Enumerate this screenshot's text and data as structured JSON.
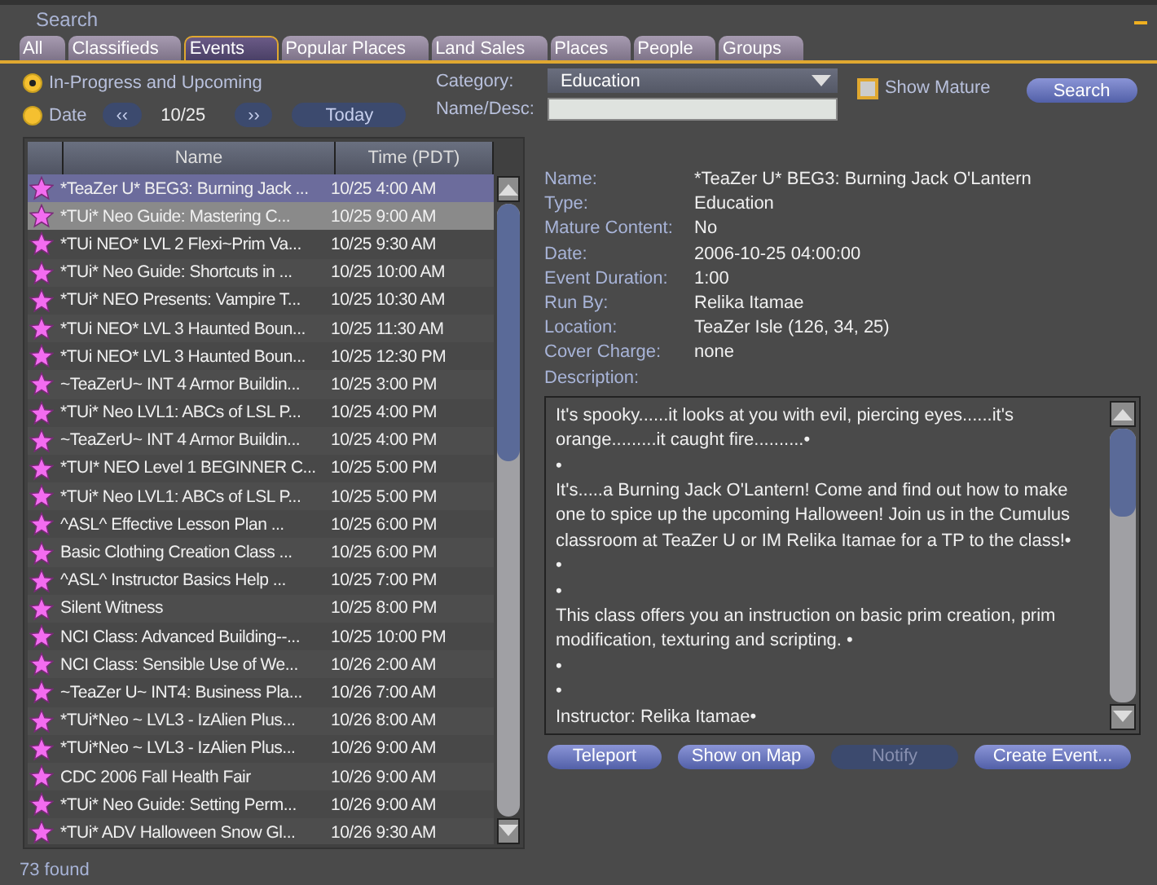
{
  "window": {
    "title": "Search"
  },
  "tabs": [
    {
      "label": "All",
      "selected": false
    },
    {
      "label": "Classifieds",
      "selected": false
    },
    {
      "label": "Events",
      "selected": true
    },
    {
      "label": "Popular Places",
      "selected": false
    },
    {
      "label": "Land Sales",
      "selected": false
    },
    {
      "label": "Places",
      "selected": false
    },
    {
      "label": "People",
      "selected": false
    },
    {
      "label": "Groups",
      "selected": false
    }
  ],
  "filters": {
    "modes": [
      {
        "label": "In-Progress and Upcoming",
        "selected": true
      },
      {
        "label": "Date",
        "selected": false
      }
    ],
    "prev": "‹‹",
    "date": "10/25",
    "next": "››",
    "today": "Today",
    "category_label": "Category:",
    "category": "Education",
    "name_label": "Name/Desc:",
    "show_mature": {
      "label": "Show Mature",
      "checked": false
    },
    "search": "Search"
  },
  "table": {
    "columns": [
      "Name",
      "Time (PDT)"
    ],
    "rows": [
      {
        "name": "*TeaZer U* BEG3: Burning Jack ...",
        "time": "10/25 4:00 AM",
        "selected": true,
        "hovered": false
      },
      {
        "name": "*TUi* Neo Guide:  Mastering C...",
        "time": "10/25 9:00 AM",
        "selected": false,
        "hovered": true
      },
      {
        "name": "*TUi NEO* LVL 2 Flexi~Prim Va...",
        "time": "10/25 9:30 AM",
        "selected": false,
        "hovered": false
      },
      {
        "name": "*TUi* Neo Guide: Shortcuts in ...",
        "time": "10/25 10:00 AM",
        "selected": false,
        "hovered": false
      },
      {
        "name": "*TUi* NEO Presents: Vampire T...",
        "time": "10/25 10:30 AM",
        "selected": false,
        "hovered": false
      },
      {
        "name": "*TUi NEO* LVL 3 Haunted Boun...",
        "time": "10/25 11:30 AM",
        "selected": false,
        "hovered": false
      },
      {
        "name": "*TUi NEO* LVL 3 Haunted Boun...",
        "time": "10/25 12:30 PM",
        "selected": false,
        "hovered": false
      },
      {
        "name": "~TeaZerU~ INT 4 Armor Buildin...",
        "time": "10/25 3:00 PM",
        "selected": false,
        "hovered": false
      },
      {
        "name": "*TUi* Neo LVL1: ABCs of LSL P...",
        "time": "10/25 4:00 PM",
        "selected": false,
        "hovered": false
      },
      {
        "name": "~TeaZerU~ INT 4 Armor Buildin...",
        "time": "10/25 4:00 PM",
        "selected": false,
        "hovered": false
      },
      {
        "name": "*TUI* NEO Level 1 BEGINNER C...",
        "time": "10/25 5:00 PM",
        "selected": false,
        "hovered": false
      },
      {
        "name": "*TUi* Neo LVL1: ABCs of LSL P...",
        "time": "10/25 5:00 PM",
        "selected": false,
        "hovered": false
      },
      {
        "name": "^ASL^ Effective Lesson Plan ...",
        "time": "10/25 6:00 PM",
        "selected": false,
        "hovered": false
      },
      {
        "name": "Basic Clothing Creation Class ...",
        "time": "10/25 6:00 PM",
        "selected": false,
        "hovered": false
      },
      {
        "name": "^ASL^ Instructor Basics Help ...",
        "time": "10/25 7:00 PM",
        "selected": false,
        "hovered": false
      },
      {
        "name": "Silent Witness",
        "time": "10/25 8:00 PM",
        "selected": false,
        "hovered": false
      },
      {
        "name": "NCI Class: Advanced Building--...",
        "time": "10/25 10:00 PM",
        "selected": false,
        "hovered": false
      },
      {
        "name": "NCI Class: Sensible Use of We...",
        "time": "10/26 2:00 AM",
        "selected": false,
        "hovered": false
      },
      {
        "name": "~TeaZer U~ INT4: Business Pla...",
        "time": "10/26 7:00 AM",
        "selected": false,
        "hovered": false
      },
      {
        "name": "*TUi*Neo ~ LVL3 - IzAlien Plus...",
        "time": "10/26 8:00 AM",
        "selected": false,
        "hovered": false
      },
      {
        "name": "*TUi*Neo ~ LVL3 - IzAlien Plus...",
        "time": "10/26 9:00 AM",
        "selected": false,
        "hovered": false
      },
      {
        "name": "CDC 2006 Fall Health Fair",
        "time": "10/26 9:00 AM",
        "selected": false,
        "hovered": false
      },
      {
        "name": "*TUi* Neo Guide: Setting Perm...",
        "time": "10/26 9:00 AM",
        "selected": false,
        "hovered": false
      },
      {
        "name": "*TUi* ADV Halloween Snow Gl...",
        "time": "10/26 9:30 AM",
        "selected": false,
        "hovered": false
      }
    ]
  },
  "details": [
    {
      "label": "Name:",
      "value": "*TeaZer U* BEG3: Burning Jack O'Lantern"
    },
    {
      "label": "Type:",
      "value": "Education"
    },
    {
      "label": "Mature Content:",
      "value": "No"
    },
    {
      "label": "Date:",
      "value": "2006-10-25 04:00:00"
    },
    {
      "label": "Event Duration:",
      "value": "1:00"
    },
    {
      "label": "Run By:",
      "value": "Relika Itamae"
    },
    {
      "label": "Location:",
      "value": "TeaZer Isle (126, 34, 25)"
    },
    {
      "label": "Cover Charge:",
      "value": "none"
    },
    {
      "label": "Description:"
    }
  ],
  "description": [
    "It's spooky......it looks at you with evil, piercing eyes......it's orange.........it caught fire..........•",
    "•",
    "It's.....a Burning Jack O'Lantern! Come and find out how to make one to spice up the upcoming Halloween! Join us in the Cumulus classroom at TeaZer U or IM Relika Itamae for a TP to the class!•",
    "•",
    "•",
    "This class offers you an instruction on basic prim creation, prim modification, texturing and scripting. •",
    "•",
    "•",
    "Instructor: Relika Itamae•"
  ],
  "buttons": [
    {
      "label": "Teleport",
      "disabled": false
    },
    {
      "label": "Show on Map",
      "disabled": false
    },
    {
      "label": "Notify",
      "disabled": true
    },
    {
      "label": "Create Event...",
      "disabled": false
    }
  ],
  "status": "73 found"
}
